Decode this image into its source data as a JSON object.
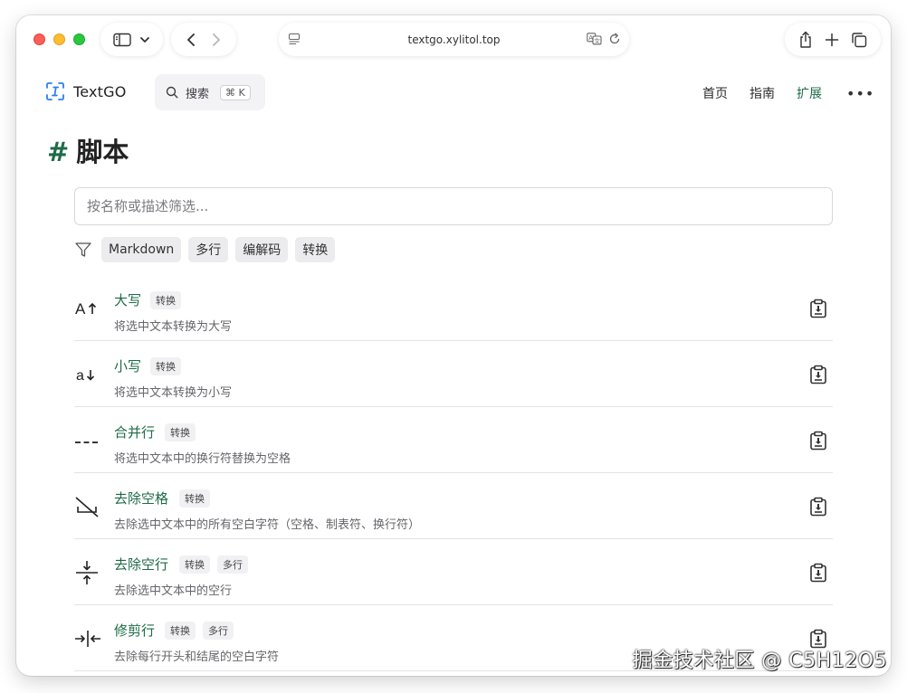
{
  "browser": {
    "url": "textgo.xylitol.top"
  },
  "site": {
    "name": "TextGO",
    "search": {
      "label": "搜索",
      "shortcut": "⌘ K"
    },
    "nav": [
      {
        "label": "首页",
        "active": false
      },
      {
        "label": "指南",
        "active": false
      },
      {
        "label": "扩展",
        "active": true
      }
    ],
    "accent_color": "#1d6b47"
  },
  "page": {
    "hash": "#",
    "title": "脚本",
    "filter_placeholder": "按名称或描述筛选...",
    "tags": [
      "Markdown",
      "多行",
      "编解码",
      "转换"
    ]
  },
  "scripts": [
    {
      "icon": "uppercase-icon",
      "name": "大写",
      "badges": [
        "转换"
      ],
      "desc": "将选中文本转换为大写"
    },
    {
      "icon": "lowercase-icon",
      "name": "小写",
      "badges": [
        "转换"
      ],
      "desc": "将选中文本转换为小写"
    },
    {
      "icon": "merge-lines-icon",
      "name": "合并行",
      "badges": [
        "转换"
      ],
      "desc": "将选中文本中的换行符替换为空格"
    },
    {
      "icon": "remove-spaces-icon",
      "name": "去除空格",
      "badges": [
        "转换"
      ],
      "desc": "去除选中文本中的所有空白字符（空格、制表符、换行符）"
    },
    {
      "icon": "remove-empty-lines-icon",
      "name": "去除空行",
      "badges": [
        "转换",
        "多行"
      ],
      "desc": "去除选中文本中的空行"
    },
    {
      "icon": "trim-lines-icon",
      "name": "修剪行",
      "badges": [
        "转换",
        "多行"
      ],
      "desc": "去除每行开头和结尾的空白字符"
    }
  ],
  "watermark": "掘金技术社区 @ C5H12O5"
}
